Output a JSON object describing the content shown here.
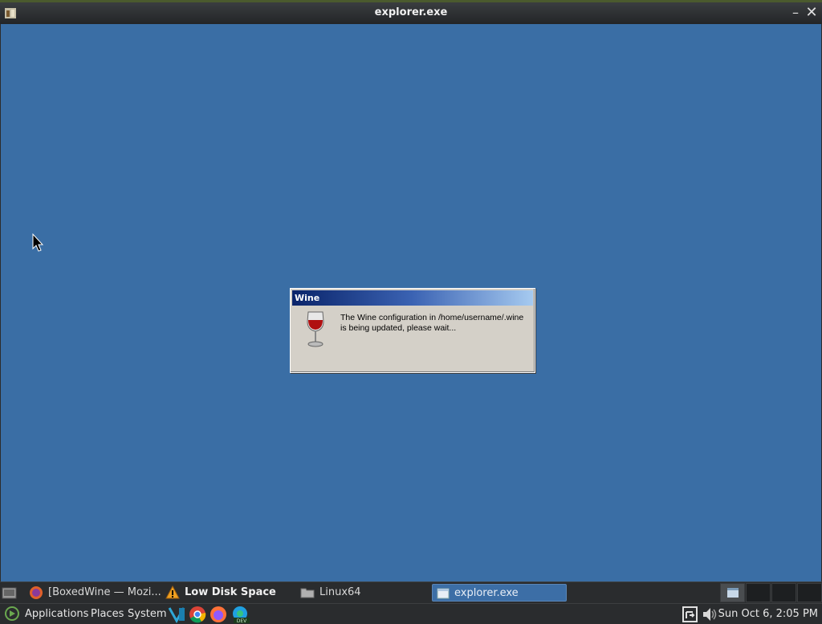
{
  "window": {
    "title": "explorer.exe",
    "minimize_icon": "minimize-icon",
    "close_icon": "close-icon"
  },
  "dialog": {
    "title": "Wine",
    "message": "The Wine configuration in /home/username/.wine is being updated, please wait...",
    "icon": "wine-glass-icon"
  },
  "taskbar": {
    "tasks": [
      {
        "label": "[BoxedWine — Mozi...",
        "icon": "firefox-icon",
        "active": false
      },
      {
        "label": "Low Disk Space",
        "icon": "warning-icon",
        "active": false
      },
      {
        "label": "Linux64",
        "icon": "folder-icon",
        "active": false
      },
      {
        "label": "explorer.exe",
        "icon": "window-icon",
        "active": true
      }
    ],
    "workspaces": 4,
    "current_workspace": 1
  },
  "panel": {
    "menus": [
      "Applications",
      "Places",
      "System"
    ],
    "launchers": [
      "vscode-icon",
      "chrome-icon",
      "firefox-icon",
      "edge-dev-icon"
    ],
    "clock": "Sun Oct  6,  2:05 PM"
  },
  "colors": {
    "desktop": "#3a6ea5",
    "dialog_bg": "#d4d0c8",
    "title_gradient_start": "#0a246a",
    "title_gradient_end": "#a6caf0"
  }
}
